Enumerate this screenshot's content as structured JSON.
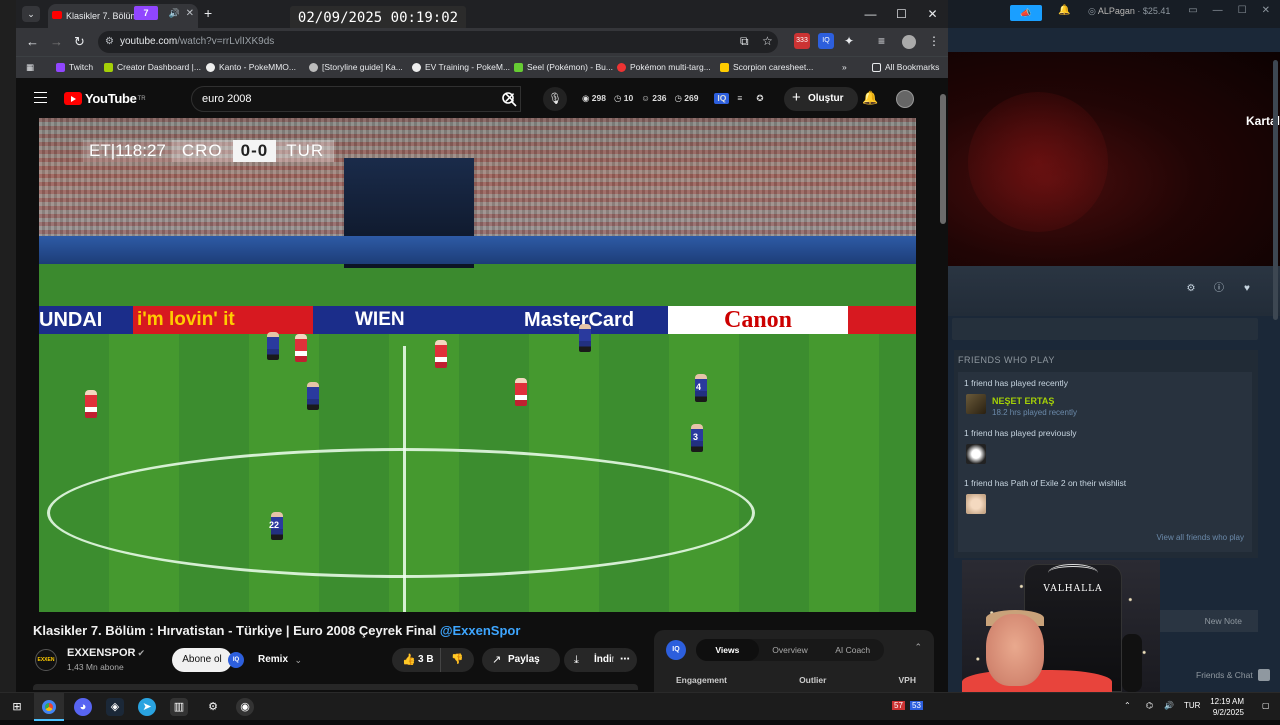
{
  "chrome": {
    "tab_title": "Klasikler 7. Bölüm",
    "twitch_badge": "7",
    "overlay_clock": "02/09/2025 00:19:02",
    "url_host": "youtube.com",
    "url_path": "/watch?v=rrLvlIXK9ds",
    "ext_badge_count": "333",
    "bookmarks": [
      "Twitch",
      "Creator Dashboard |...",
      "Kanto - PokeMMO...",
      "[Storyline guide] Ka...",
      "EV Training - PokeM...",
      "Seel (Pokémon) - Bu...",
      "Pokémon multi-targ...",
      "Scorpion caresheet..."
    ],
    "all_bookmarks": "All Bookmarks"
  },
  "youtube": {
    "logo_text": "YouTube",
    "logo_region": "TR",
    "search_value": "euro 2008",
    "stats": [
      "298",
      "10",
      "236",
      "269"
    ],
    "create_label": "Oluştur",
    "scorebug": {
      "clock": "ET|118:27",
      "home": "CRO",
      "score": "0-0",
      "away": "TUR"
    },
    "boards": [
      "UNDAI",
      "i'm lovin' it",
      "WIEN",
      "MasterCard",
      "Canon"
    ],
    "jersey_numbers": [
      "4",
      "3",
      "22"
    ],
    "video_title": "Klasikler 7. Bölüm : Hırvatistan - Türkiye | Euro 2008 Çeyrek Final",
    "video_title_tag": "@ExxenSpor",
    "channel_name": "EXXENSPOR",
    "channel_avatar_text": "EXXEN",
    "subscribers": "1,43 Mn abone",
    "subscribe_label": "Abone ol",
    "remix_label": "Remix",
    "remix_icon_text": "IQ",
    "like_count": "3 B",
    "share_label": "Paylaş",
    "download_label": "İndir",
    "analytics": {
      "logo_text": "IQ",
      "tabs": [
        "Views",
        "Overview",
        "AI Coach"
      ],
      "active_tab": "Views",
      "columns": [
        "Engagement",
        "Outlier",
        "VPH"
      ]
    }
  },
  "steam": {
    "account_name": "ALPagan",
    "balance": "$25.41",
    "hero_brand": "Kartal",
    "friends_header": "FRIENDS WHO PLAY",
    "recent_label": "1 friend has played recently",
    "friend_name": "NEŞET ERTAŞ",
    "friend_status": "18.2 hrs played recently",
    "previous_label": "1 friend has played previously",
    "wishlist_label": "1 friend has Path of Exile 2 on their wishlist",
    "view_all": "View all friends who play",
    "new_note": "New Note",
    "friends_chat": "Friends & Chat"
  },
  "webcam": {
    "chair_text": "VALHALLA"
  },
  "taskbar": {
    "language": "TUR",
    "time": "12:19 AM",
    "date": "9/2/2025",
    "tray_badges": [
      "57",
      "53"
    ]
  },
  "colors": {
    "youtube_red": "#ff0000",
    "steam_bg": "#1b2838",
    "friend_ingame": "#a4d007",
    "link_blue": "#3ea6ff"
  }
}
